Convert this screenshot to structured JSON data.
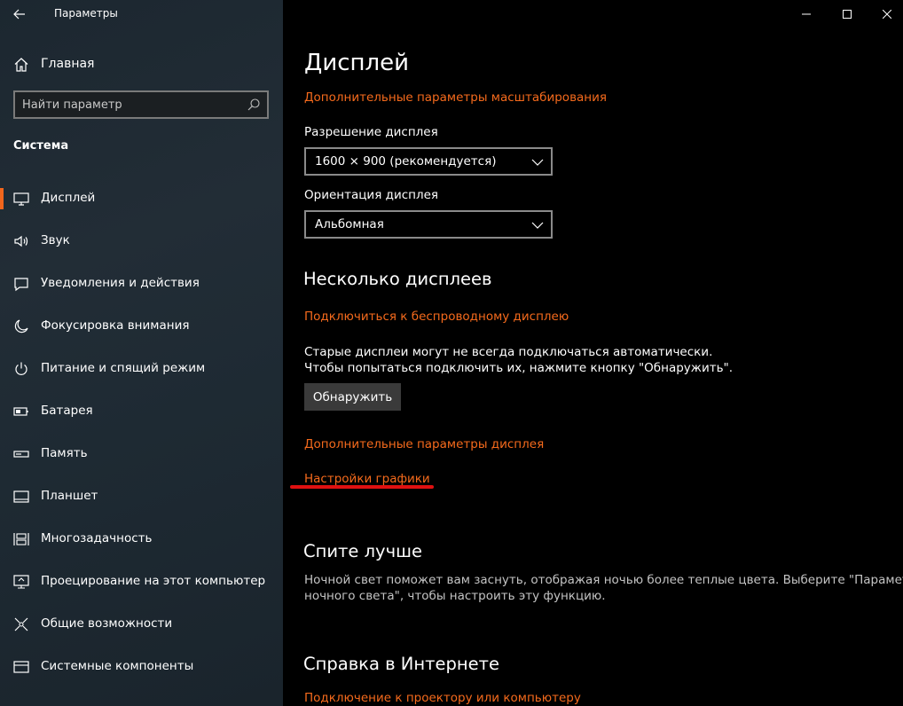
{
  "window": {
    "title": "Параметры"
  },
  "sidebar": {
    "home_label": "Главная",
    "search_placeholder": "Найти параметр",
    "section_title": "Система",
    "items": [
      {
        "label": "Дисплей",
        "icon": "monitor-icon",
        "active": true
      },
      {
        "label": "Звук",
        "icon": "speaker-icon",
        "active": false
      },
      {
        "label": "Уведомления и действия",
        "icon": "notification-icon",
        "active": false
      },
      {
        "label": "Фокусировка внимания",
        "icon": "moon-icon",
        "active": false
      },
      {
        "label": "Питание и спящий режим",
        "icon": "power-icon",
        "active": false
      },
      {
        "label": "Батарея",
        "icon": "battery-icon",
        "active": false
      },
      {
        "label": "Память",
        "icon": "storage-icon",
        "active": false
      },
      {
        "label": "Планшет",
        "icon": "tablet-icon",
        "active": false
      },
      {
        "label": "Многозадачность",
        "icon": "multitasking-icon",
        "active": false
      },
      {
        "label": "Проецирование на этот компьютер",
        "icon": "projecting-icon",
        "active": false
      },
      {
        "label": "Общие возможности",
        "icon": "shared-experiences-icon",
        "active": false
      },
      {
        "label": "Системные компоненты",
        "icon": "system-components-icon",
        "active": false
      }
    ]
  },
  "main": {
    "title": "Дисплей",
    "scaling_link": "Дополнительные параметры масштабирования",
    "resolution_label": "Разрешение дисплея",
    "resolution_value": "1600 × 900 (рекомендуется)",
    "orientation_label": "Ориентация дисплея",
    "orientation_value": "Альбомная",
    "multi_heading": "Несколько дисплеев",
    "wireless_link": "Подключиться к беспроводному дисплею",
    "old_displays_line1": "Старые дисплеи могут не всегда подключаться автоматически.",
    "old_displays_line2": "Чтобы попытаться подключить их, нажмите кнопку \"Обнаружить\".",
    "detect_button": "Обнаружить",
    "advanced_link": "Дополнительные параметры дисплея",
    "graphics_link": "Настройки графики",
    "sleep_heading": "Спите лучше",
    "sleep_text_line1": "Ночной свет поможет вам заснуть, отображая ночью более теплые цвета. Выберите \"Параметры",
    "sleep_text_line2": "ночного света\", чтобы настроить эту функцию.",
    "help_heading": "Справка в Интернете",
    "projector_link": "Подключение к проектору или компьютеру"
  },
  "colors": {
    "accent": "#f56a1c",
    "annotation_underline": "#e01010"
  }
}
